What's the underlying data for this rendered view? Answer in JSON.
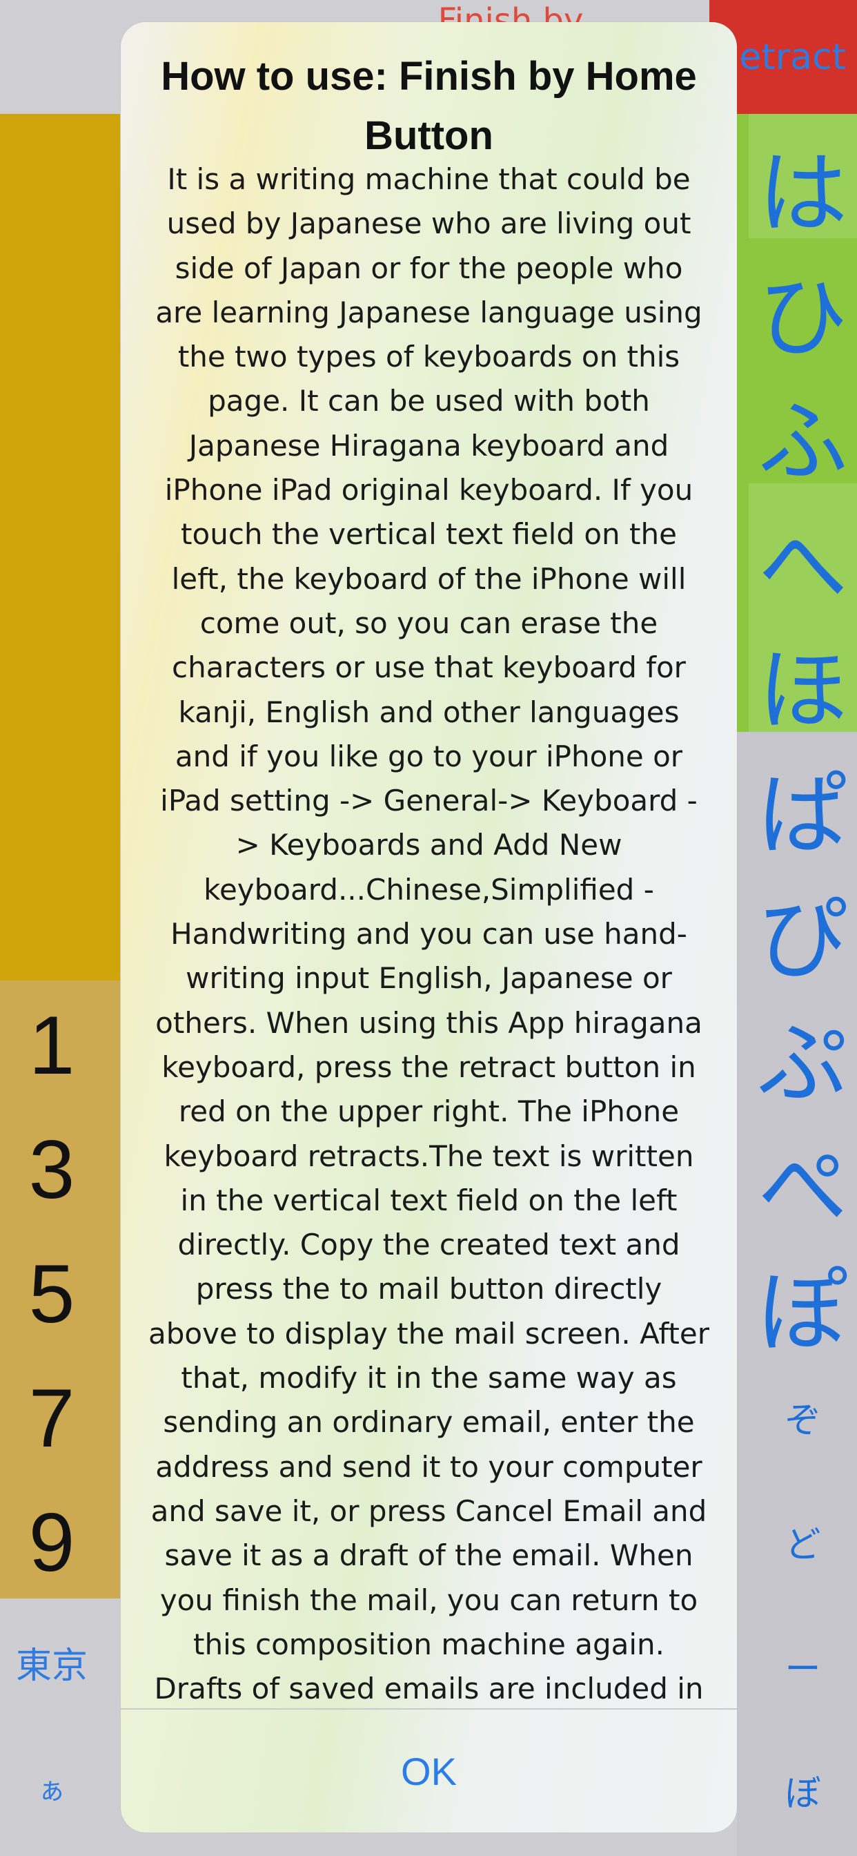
{
  "background": {
    "finish_title": "Finish by",
    "retract_label": "etract",
    "left_numbers": [
      "1",
      "3",
      "5",
      "7",
      "9"
    ],
    "left_keys": [
      "東京",
      "ぁ"
    ],
    "right_kana_large": [
      "は",
      "ひ",
      "ふ",
      "へ",
      "ほ",
      "ぱ",
      "ぴ",
      "ぷ",
      "ぺ",
      "ぽ"
    ],
    "right_kana_small": [
      "ぞ",
      "ど",
      "ー",
      "ぼ"
    ]
  },
  "dialog": {
    "title": "How to use: Finish by Home Button",
    "body": "It is a writing machine that could be used by Japanese who are living out side of Japan or for the people who are learning Japanese language using the two types of keyboards on this page. It can be used with both Japanese Hiragana keyboard and iPhone iPad original keyboard. If you touch the vertical text field on the left, the keyboard of the iPhone will come out, so you can erase the characters or use that keyboard for kanji, English and other languages and if you like go to your iPhone or iPad setting -> General-> Keyboard -> Keyboards and Add New keyboard...Chinese,Simplified - Handwriting and you can use hand-writing input English, Japanese or others. When using this App hiragana keyboard, press the retract button in red on the upper right. The iPhone keyboard retracts.The text is written in the vertical text field on the left directly. Copy the created text and press the to mail button directly above to display the mail screen. After that, modify it in the same way as sending an ordinary email, enter the address and send it to your computer and save it, or press Cancel Email and save it as a draft of the email. When you finish the mail, you can return to this composition machine again. Drafts of saved emails are included in the email program that comes with your iPhone.",
    "ok_label": "OK"
  },
  "colors": {
    "retract_red": "#d2322a",
    "left_yellow": "#cfa40a",
    "number_panel": "#cdaa52",
    "kana_green": "#8dc63f",
    "link_blue": "#2b7ce8"
  }
}
